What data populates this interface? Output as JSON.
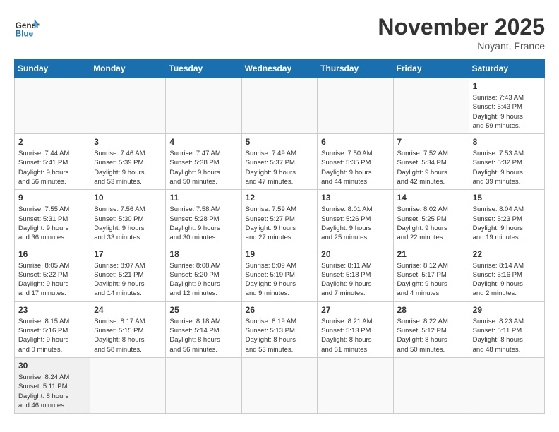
{
  "header": {
    "logo_general": "General",
    "logo_blue": "Blue",
    "month_title": "November 2025",
    "subtitle": "Noyant, France"
  },
  "weekdays": [
    "Sunday",
    "Monday",
    "Tuesday",
    "Wednesday",
    "Thursday",
    "Friday",
    "Saturday"
  ],
  "weeks": [
    [
      {
        "day": "",
        "info": ""
      },
      {
        "day": "",
        "info": ""
      },
      {
        "day": "",
        "info": ""
      },
      {
        "day": "",
        "info": ""
      },
      {
        "day": "",
        "info": ""
      },
      {
        "day": "",
        "info": ""
      },
      {
        "day": "1",
        "info": "Sunrise: 7:43 AM\nSunset: 5:43 PM\nDaylight: 9 hours\nand 59 minutes."
      }
    ],
    [
      {
        "day": "2",
        "info": "Sunrise: 7:44 AM\nSunset: 5:41 PM\nDaylight: 9 hours\nand 56 minutes."
      },
      {
        "day": "3",
        "info": "Sunrise: 7:46 AM\nSunset: 5:39 PM\nDaylight: 9 hours\nand 53 minutes."
      },
      {
        "day": "4",
        "info": "Sunrise: 7:47 AM\nSunset: 5:38 PM\nDaylight: 9 hours\nand 50 minutes."
      },
      {
        "day": "5",
        "info": "Sunrise: 7:49 AM\nSunset: 5:37 PM\nDaylight: 9 hours\nand 47 minutes."
      },
      {
        "day": "6",
        "info": "Sunrise: 7:50 AM\nSunset: 5:35 PM\nDaylight: 9 hours\nand 44 minutes."
      },
      {
        "day": "7",
        "info": "Sunrise: 7:52 AM\nSunset: 5:34 PM\nDaylight: 9 hours\nand 42 minutes."
      },
      {
        "day": "8",
        "info": "Sunrise: 7:53 AM\nSunset: 5:32 PM\nDaylight: 9 hours\nand 39 minutes."
      }
    ],
    [
      {
        "day": "9",
        "info": "Sunrise: 7:55 AM\nSunset: 5:31 PM\nDaylight: 9 hours\nand 36 minutes."
      },
      {
        "day": "10",
        "info": "Sunrise: 7:56 AM\nSunset: 5:30 PM\nDaylight: 9 hours\nand 33 minutes."
      },
      {
        "day": "11",
        "info": "Sunrise: 7:58 AM\nSunset: 5:28 PM\nDaylight: 9 hours\nand 30 minutes."
      },
      {
        "day": "12",
        "info": "Sunrise: 7:59 AM\nSunset: 5:27 PM\nDaylight: 9 hours\nand 27 minutes."
      },
      {
        "day": "13",
        "info": "Sunrise: 8:01 AM\nSunset: 5:26 PM\nDaylight: 9 hours\nand 25 minutes."
      },
      {
        "day": "14",
        "info": "Sunrise: 8:02 AM\nSunset: 5:25 PM\nDaylight: 9 hours\nand 22 minutes."
      },
      {
        "day": "15",
        "info": "Sunrise: 8:04 AM\nSunset: 5:23 PM\nDaylight: 9 hours\nand 19 minutes."
      }
    ],
    [
      {
        "day": "16",
        "info": "Sunrise: 8:05 AM\nSunset: 5:22 PM\nDaylight: 9 hours\nand 17 minutes."
      },
      {
        "day": "17",
        "info": "Sunrise: 8:07 AM\nSunset: 5:21 PM\nDaylight: 9 hours\nand 14 minutes."
      },
      {
        "day": "18",
        "info": "Sunrise: 8:08 AM\nSunset: 5:20 PM\nDaylight: 9 hours\nand 12 minutes."
      },
      {
        "day": "19",
        "info": "Sunrise: 8:09 AM\nSunset: 5:19 PM\nDaylight: 9 hours\nand 9 minutes."
      },
      {
        "day": "20",
        "info": "Sunrise: 8:11 AM\nSunset: 5:18 PM\nDaylight: 9 hours\nand 7 minutes."
      },
      {
        "day": "21",
        "info": "Sunrise: 8:12 AM\nSunset: 5:17 PM\nDaylight: 9 hours\nand 4 minutes."
      },
      {
        "day": "22",
        "info": "Sunrise: 8:14 AM\nSunset: 5:16 PM\nDaylight: 9 hours\nand 2 minutes."
      }
    ],
    [
      {
        "day": "23",
        "info": "Sunrise: 8:15 AM\nSunset: 5:16 PM\nDaylight: 9 hours\nand 0 minutes."
      },
      {
        "day": "24",
        "info": "Sunrise: 8:17 AM\nSunset: 5:15 PM\nDaylight: 8 hours\nand 58 minutes."
      },
      {
        "day": "25",
        "info": "Sunrise: 8:18 AM\nSunset: 5:14 PM\nDaylight: 8 hours\nand 56 minutes."
      },
      {
        "day": "26",
        "info": "Sunrise: 8:19 AM\nSunset: 5:13 PM\nDaylight: 8 hours\nand 53 minutes."
      },
      {
        "day": "27",
        "info": "Sunrise: 8:21 AM\nSunset: 5:13 PM\nDaylight: 8 hours\nand 51 minutes."
      },
      {
        "day": "28",
        "info": "Sunrise: 8:22 AM\nSunset: 5:12 PM\nDaylight: 8 hours\nand 50 minutes."
      },
      {
        "day": "29",
        "info": "Sunrise: 8:23 AM\nSunset: 5:11 PM\nDaylight: 8 hours\nand 48 minutes."
      }
    ],
    [
      {
        "day": "30",
        "info": "Sunrise: 8:24 AM\nSunset: 5:11 PM\nDaylight: 8 hours\nand 46 minutes."
      },
      {
        "day": "",
        "info": ""
      },
      {
        "day": "",
        "info": ""
      },
      {
        "day": "",
        "info": ""
      },
      {
        "day": "",
        "info": ""
      },
      {
        "day": "",
        "info": ""
      },
      {
        "day": "",
        "info": ""
      }
    ]
  ]
}
